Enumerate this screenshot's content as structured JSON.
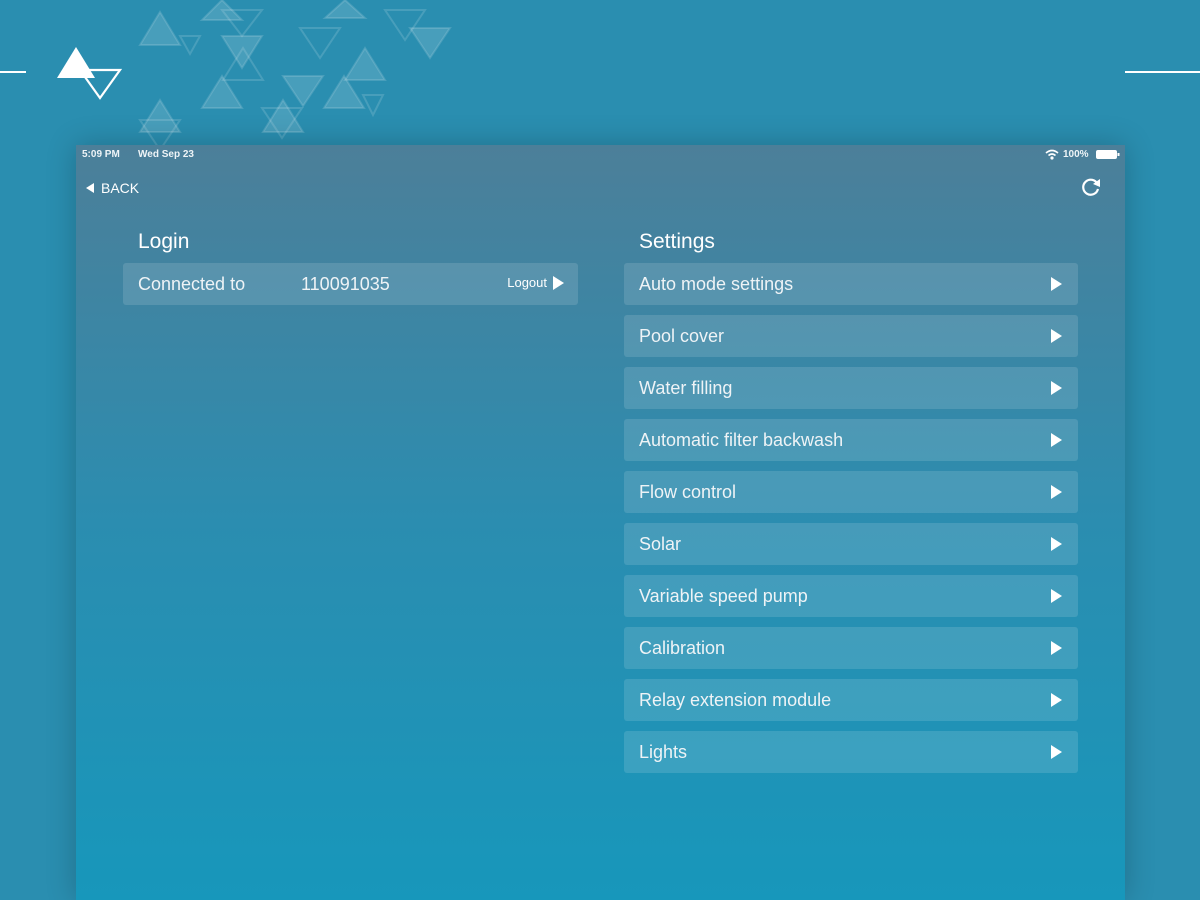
{
  "status_bar": {
    "time": "5:09 PM",
    "date": "Wed Sep 23",
    "battery": "100%",
    "icons": [
      "wifi-icon",
      "battery-icon"
    ]
  },
  "nav": {
    "back_label": "BACK",
    "back_icon": "chevron-left-icon",
    "refresh_icon": "refresh-icon"
  },
  "login": {
    "title": "Login",
    "connected_label": "Connected to",
    "connected_value": "110091035",
    "logout_label": "Logout",
    "logout_icon": "play-arrow-icon"
  },
  "settings": {
    "title": "Settings",
    "item_icon": "play-arrow-icon",
    "items": [
      {
        "label": "Auto mode settings"
      },
      {
        "label": "Pool cover"
      },
      {
        "label": "Water filling"
      },
      {
        "label": "Automatic filter backwash"
      },
      {
        "label": "Flow control"
      },
      {
        "label": "Solar"
      },
      {
        "label": "Variable speed pump"
      },
      {
        "label": "Calibration"
      },
      {
        "label": "Relay extension module"
      },
      {
        "label": "Lights"
      }
    ]
  },
  "colors": {
    "background": "#2a8eb0",
    "panel_top": "#4c7f99",
    "panel_bottom": "#1797bb",
    "text": "#ffffff"
  }
}
